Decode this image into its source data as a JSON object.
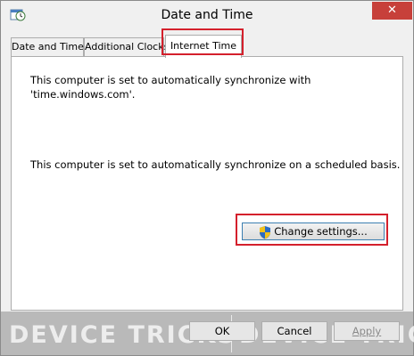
{
  "window": {
    "title": "Date and Time",
    "close_glyph": "✕"
  },
  "tabs": [
    {
      "label": "Date and Time"
    },
    {
      "label": "Additional Clocks"
    },
    {
      "label": "Internet Time",
      "active": true
    }
  ],
  "panel": {
    "message_sync_line1": "This computer is set to automatically synchronize with",
    "message_sync_line2": "'time.windows.com'.",
    "message_schedule": "This computer is set to automatically synchronize on a scheduled basis.",
    "change_settings_label": "Change settings..."
  },
  "buttons": {
    "ok": "OK",
    "cancel": "Cancel",
    "apply": "Apply"
  },
  "watermark": {
    "left": "DEVICE TRICKS",
    "right": "DEVICE TRICKS"
  },
  "colors": {
    "highlight": "#d4202c",
    "close": "#c7403a",
    "panel_bg": "#ffffff",
    "window_bg": "#f0f0f0"
  },
  "icons": {
    "app": "date-time-app-icon",
    "shield": "uac-shield-icon",
    "close": "close-icon"
  }
}
